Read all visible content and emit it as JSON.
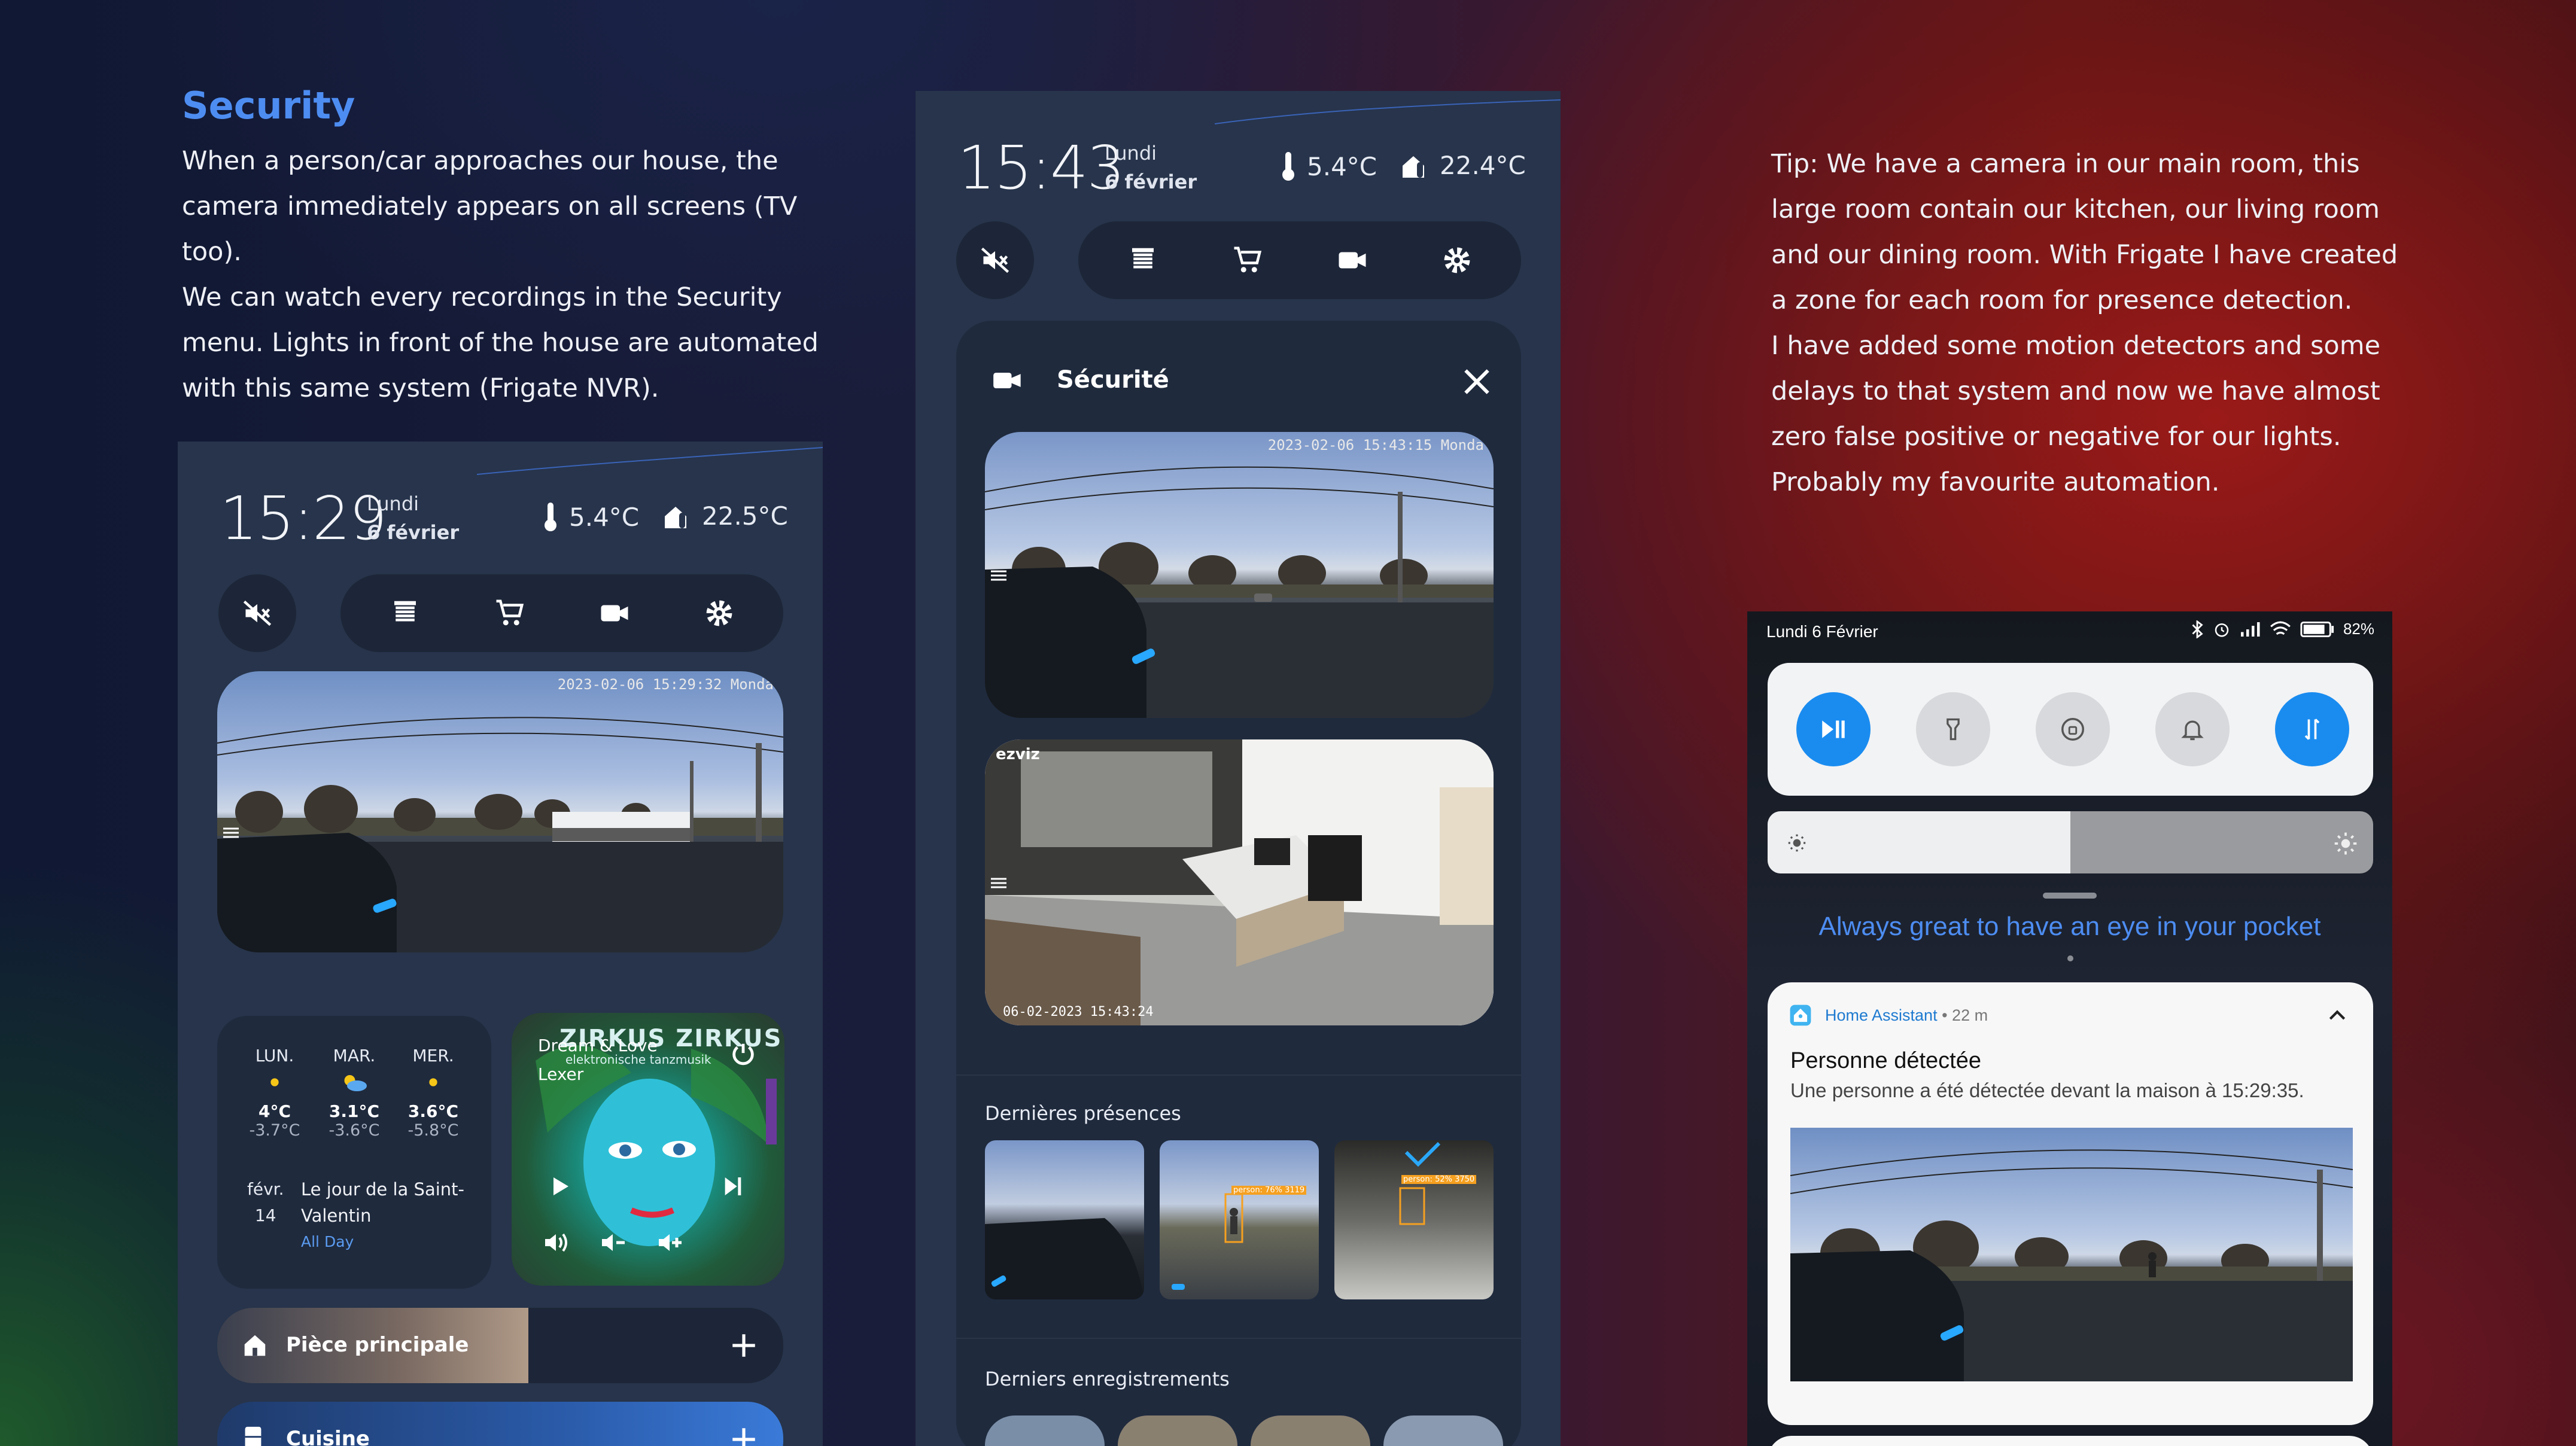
{
  "security": {
    "title": "Security",
    "lines": [
      "When a person/car approaches our house, the",
      "camera immediately appears on all screens (TV too).",
      "We can watch every recordings in the Security",
      "menu. Lights in front of the house are automated",
      "with this same system (Frigate NVR)."
    ]
  },
  "tip": {
    "lines": [
      "Tip: We have a camera in our main room, this",
      "large room contain our kitchen, our living room",
      "and our dining room. With Frigate I have created",
      "a zone for each room for presence detection.",
      "I have added some motion detectors and some",
      "delays to that system and now we have almost",
      "zero false positive or negative for our lights.",
      "Probably my favourite automation."
    ]
  },
  "phone1": {
    "time": "15:29",
    "day": "Lundi",
    "date": "6 février",
    "temp_out": "5.4°C",
    "temp_in": "22.5°C",
    "cam_timestamp": "2023-02-06 15:29:32 Monda",
    "forecast": [
      {
        "day": "LUN.",
        "hi": "4°C",
        "lo": "-3.7°C"
      },
      {
        "day": "MAR.",
        "hi": "3.1°C",
        "lo": "-3.6°C"
      },
      {
        "day": "MER.",
        "hi": "3.6°C",
        "lo": "-5.8°C"
      }
    ],
    "event_month": "févr.",
    "event_day": "14",
    "event_title_1": "Le jour de la Saint-",
    "event_title_2": "Valentin",
    "event_time": "All Day",
    "media_title": "Dream & Love",
    "media_artist": "Lexer",
    "album_big": "ZIRKUS ZIRKUS",
    "album_sub": "elektronische tanzmusik",
    "room1": "Pièce principale",
    "room2": "Cuisine"
  },
  "phone2": {
    "time": "15:43",
    "day": "Lundi",
    "date": "6 février",
    "temp_out": "5.4°C",
    "temp_in": "22.4°C",
    "dialog_title": "Sécurité",
    "cam1_timestamp": "2023-02-06 15:43:15 Monda",
    "cam2_brand": "ezviz",
    "cam2_timestamp": "06-02-2023 15:43:24",
    "recent_label": "Dernières présences",
    "recordings_label": "Derniers enregistrements",
    "det1": "person: 76% 3119",
    "det2": "person: 52% 3750"
  },
  "phone3": {
    "status_date": "Lundi 6 Février",
    "battery": "82%",
    "caption": "Always great to have an eye in your pocket",
    "app_name": "Home Assistant",
    "ago": "22 m",
    "notif_title": "Personne détectée",
    "notif_body": "Une personne a été détectée devant la maison à 15:29:35."
  },
  "colors": {
    "accent_blue": "#4d8df2",
    "panel": "#27344b",
    "card": "#1f2a3d",
    "toggle_blue": "#1a8cf0"
  }
}
